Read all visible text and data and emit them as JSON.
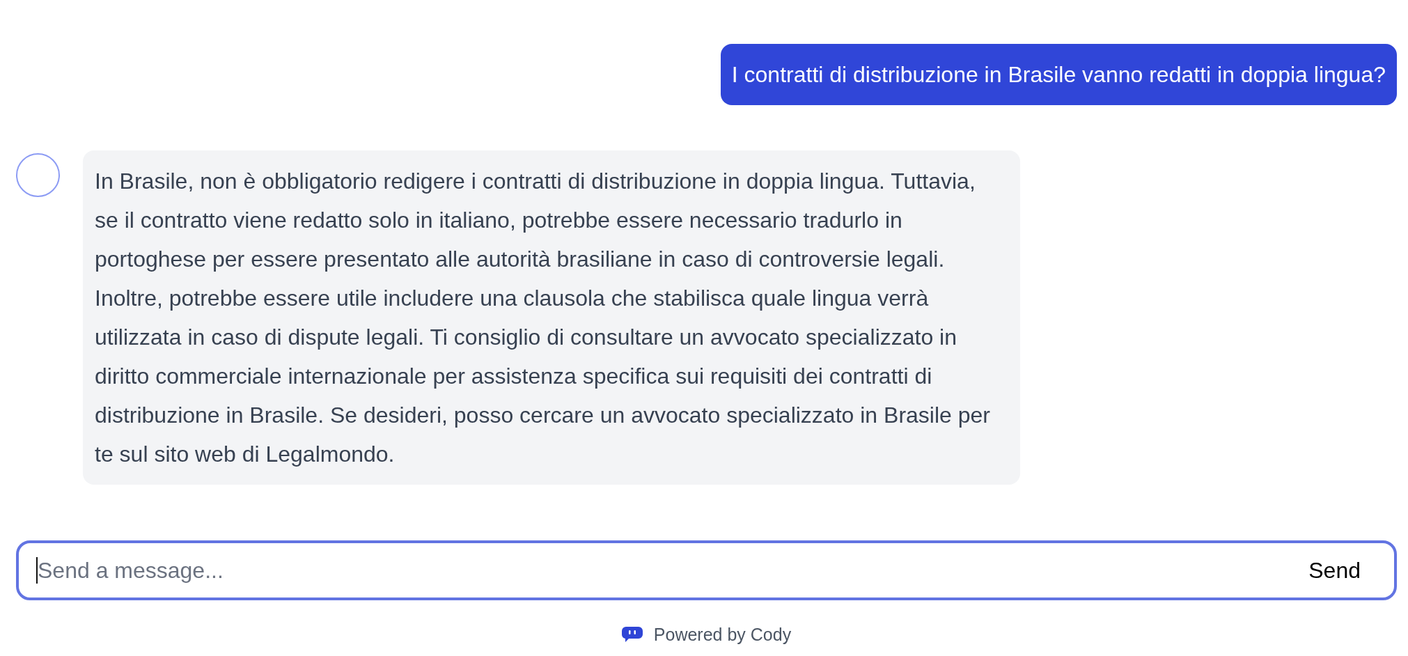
{
  "messages": [
    {
      "kind": "user",
      "text": "I contratti di distribuzione in Brasile vanno redatti in doppia lingua?"
    },
    {
      "kind": "assistant",
      "text": "In Brasile, non è obbligatorio redigere i contratti di distribuzione in doppia lingua. Tuttavia, se il contratto viene redatto solo in italiano, potrebbe essere necessario tradurlo in portoghese per essere presentato alle autorità brasiliane in caso di controversie legali. Inoltre, potrebbe essere utile includere una clausola che stabilisca quale lingua verrà utilizzata in caso di dispute legali. Ti consiglio di consultare un avvocato specializzato in diritto commerciale internazionale per assistenza specifica sui requisiti dei contratti di distribuzione in Brasile. Se desideri, posso cercare un avvocato specializzato in Brasile per te sul sito web di Legalmondo."
    }
  ],
  "composer": {
    "placeholder": "Send a message...",
    "focused": true,
    "button": "Send"
  },
  "footer": {
    "text": "Powered by Cody"
  }
}
